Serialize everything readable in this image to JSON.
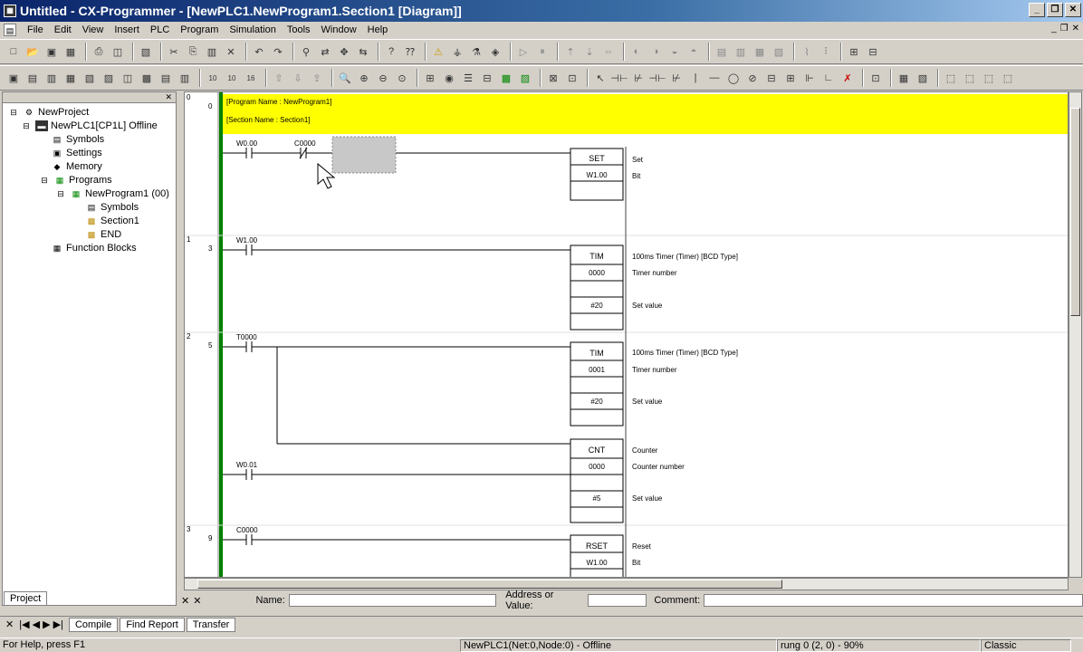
{
  "window": {
    "title": "Untitled - CX-Programmer - [NewPLC1.NewProgram1.Section1 [Diagram]]",
    "app_icon": "cx-programmer-icon"
  },
  "menu": [
    "File",
    "Edit",
    "View",
    "Insert",
    "PLC",
    "Program",
    "Simulation",
    "Tools",
    "Window",
    "Help"
  ],
  "project_tree": {
    "items": [
      {
        "label": "NewProject",
        "icon": "project-icon"
      },
      {
        "label": "NewPLC1[CP1L] Offline",
        "icon": "plc-icon"
      },
      {
        "label": "Symbols",
        "icon": "symbols-icon"
      },
      {
        "label": "Settings",
        "icon": "settings-icon"
      },
      {
        "label": "Memory",
        "icon": "memory-icon"
      },
      {
        "label": "Programs",
        "icon": "programs-icon"
      },
      {
        "label": "NewProgram1 (00)",
        "icon": "program-icon"
      },
      {
        "label": "Symbols",
        "icon": "symbols-icon"
      },
      {
        "label": "Section1",
        "icon": "section-icon"
      },
      {
        "label": "END",
        "icon": "section-icon"
      },
      {
        "label": "Function Blocks",
        "icon": "function-blocks-icon"
      }
    ],
    "tab": "Project"
  },
  "diagram": {
    "header": {
      "program_name": "[Program Name : NewProgram1]",
      "section_name": "[Section Name : Section1]"
    },
    "rungs": [
      {
        "num": "0",
        "step": "0",
        "contacts": [
          "W0.00",
          "C0000"
        ],
        "instruction": "SET",
        "operands": [
          "W1.00"
        ],
        "comments": [
          "Set",
          "Bit"
        ]
      },
      {
        "num": "1",
        "step": "3",
        "contacts": [
          "W1.00"
        ],
        "instruction": "TIM",
        "operands": [
          "0000",
          "#20"
        ],
        "comments": [
          "100ms Timer (Timer) [BCD Type]",
          "Timer number",
          "Set value"
        ]
      },
      {
        "num": "2",
        "step": "5",
        "contacts": [
          "T0000",
          "W0.01"
        ],
        "instruction": "TIM",
        "operands": [
          "0001",
          "#20"
        ],
        "comments": [
          "100ms Timer (Timer) [BCD Type]",
          "Timer number",
          "Set value"
        ],
        "instruction2": "CNT",
        "operands2": [
          "0000",
          "#5"
        ],
        "comments2": [
          "Counter",
          "Counter number",
          "Set value"
        ]
      },
      {
        "num": "3",
        "step": "9",
        "contacts": [
          "C0000"
        ],
        "instruction": "RSET",
        "operands": [
          "W1.00"
        ],
        "comments": [
          "Reset",
          "Bit"
        ]
      }
    ]
  },
  "fields": {
    "name_label": "Name:",
    "address_label": "Address or Value:",
    "comment_label": "Comment:"
  },
  "bottom_tabs": [
    "Compile",
    "Find Report",
    "Transfer"
  ],
  "status": {
    "help": "For Help, press F1",
    "plc": "NewPLC1(Net:0,Node:0) - Offline",
    "rung": "rung 0 (2, 0)  - 90%",
    "mode": "Classic"
  },
  "colors": {
    "header_bg": "#ffff00",
    "rail": "#008000"
  }
}
